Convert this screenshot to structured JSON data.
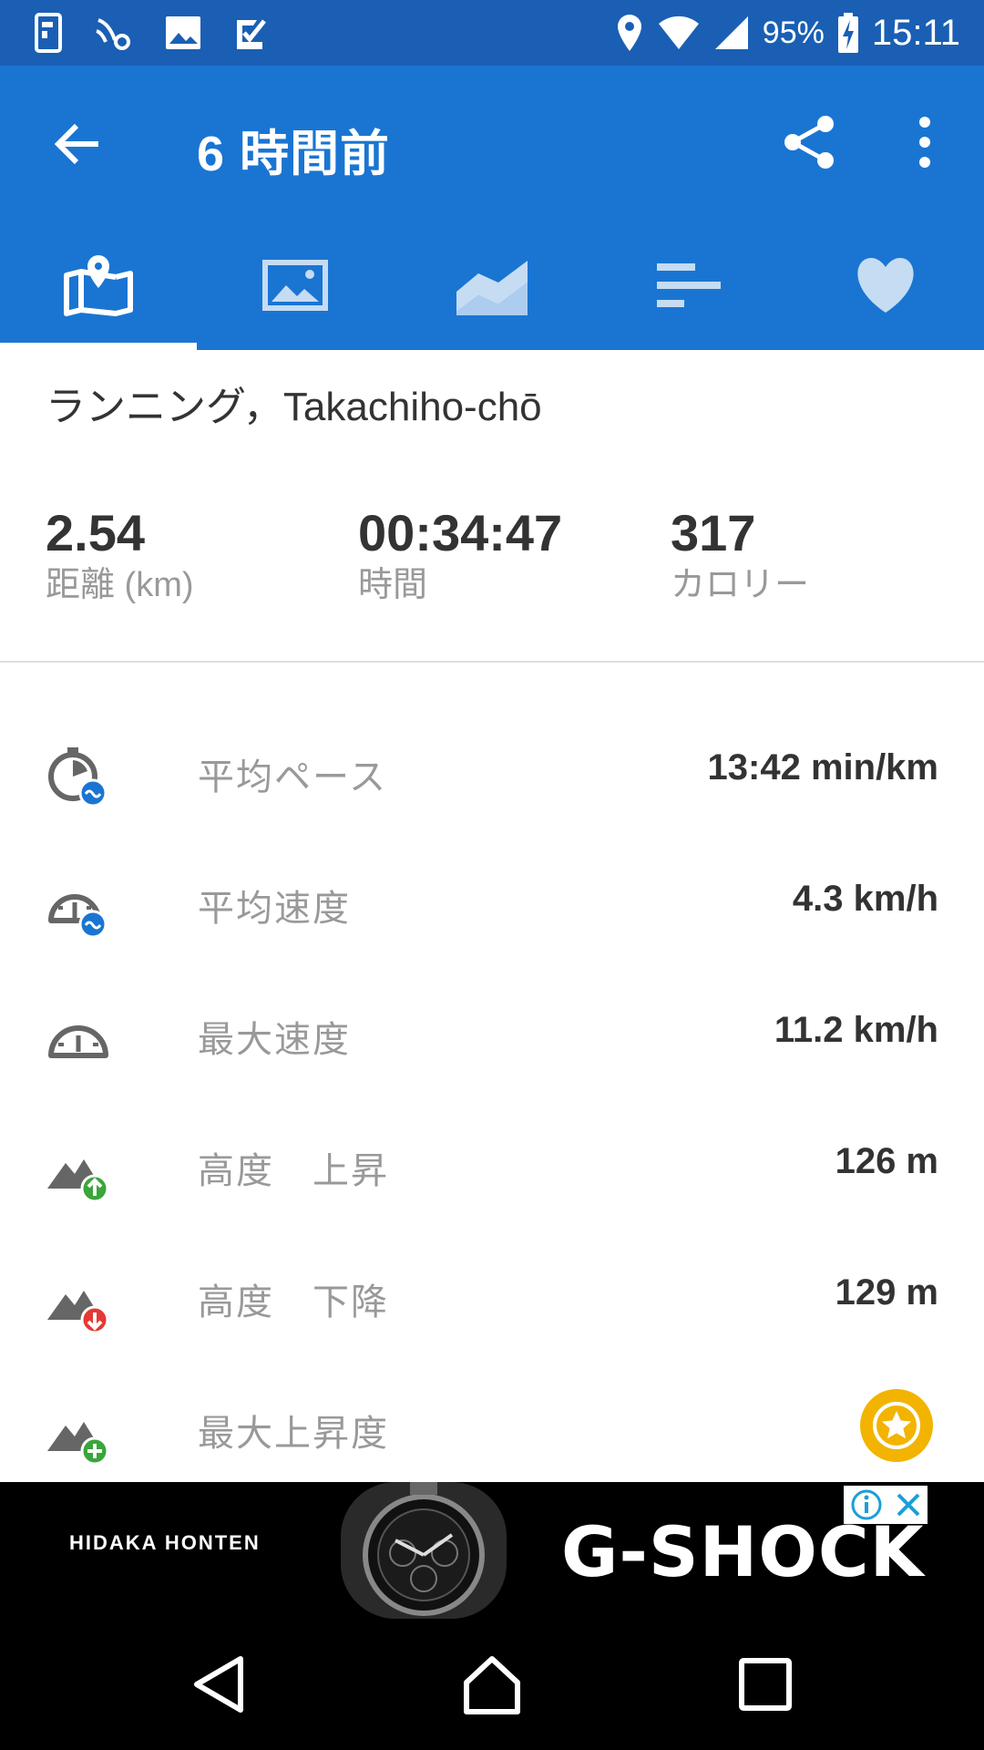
{
  "status_bar": {
    "battery": "95%",
    "time": "15:11"
  },
  "app_bar": {
    "title": "6 時間前"
  },
  "tabs": [
    {
      "icon": "map-pin-icon",
      "active": true
    },
    {
      "icon": "photo-icon",
      "active": false
    },
    {
      "icon": "chart-icon",
      "active": false
    },
    {
      "icon": "bars-icon",
      "active": false
    },
    {
      "icon": "heart-icon",
      "active": false
    }
  ],
  "activity": {
    "title": "ランニング，Takachiho-chō"
  },
  "summary": [
    {
      "value": "2.54",
      "label": "距離 (km)"
    },
    {
      "value": "00:34:47",
      "label": "時間"
    },
    {
      "value": "317",
      "label": "カロリー"
    }
  ],
  "metrics": [
    {
      "icon": "stopwatch-avg-icon",
      "label": "平均ペース",
      "value": "13:42 min/km"
    },
    {
      "icon": "speedometer-avg-icon",
      "label": "平均速度",
      "value": "4.3 km/h"
    },
    {
      "icon": "speedometer-icon",
      "label": "最大速度",
      "value": "11.2 km/h"
    },
    {
      "icon": "mountain-up-icon",
      "label": "高度　上昇",
      "value": "126 m"
    },
    {
      "icon": "mountain-down-icon",
      "label": "高度　下降",
      "value": "129 m"
    },
    {
      "icon": "mountain-plus-icon",
      "label": "最大上昇度",
      "value": ""
    }
  ],
  "ad": {
    "brand": "HIDAKA HONTEN",
    "headline": "G-SHOCK"
  },
  "colors": {
    "primary": "#1a75d2",
    "status_bar": "#1a5fb4",
    "star": "#f2b400",
    "up": "#3aa53a",
    "down": "#e53935",
    "blue_badge": "#1a75d2"
  }
}
